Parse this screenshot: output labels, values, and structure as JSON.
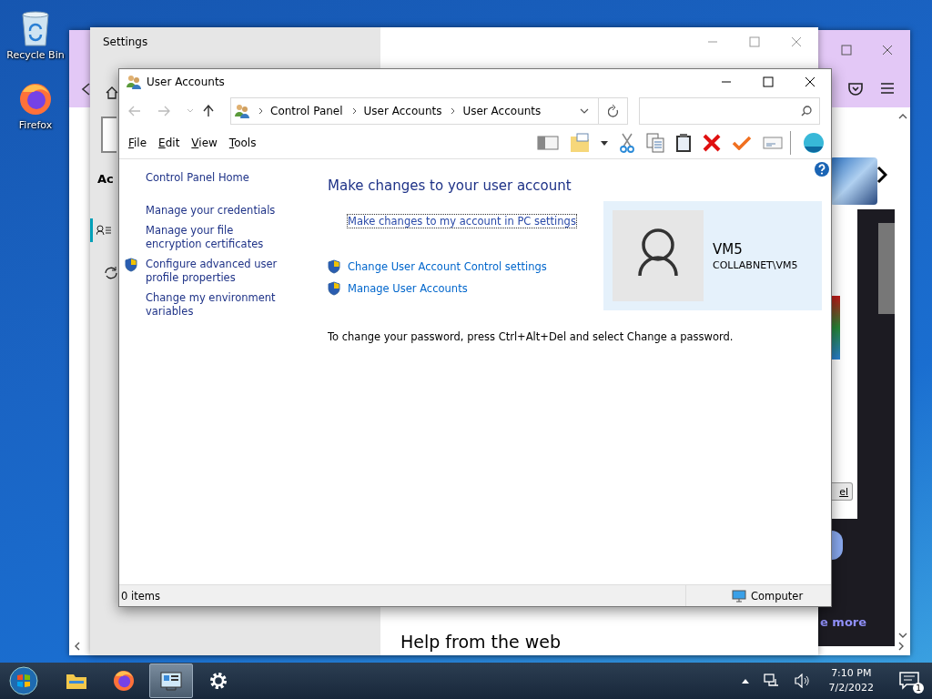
{
  "desktop_icons": [
    {
      "label": "Recycle Bin",
      "kind": "recycle"
    },
    {
      "label": "Firefox",
      "kind": "firefox"
    }
  ],
  "browser_window": {
    "partial_button": "el",
    "partial_link": "e more"
  },
  "settings_window": {
    "title": "Settings",
    "partial_heading": "Ac",
    "help_heading": "Help from the web"
  },
  "window": {
    "title": "User Accounts",
    "address": [
      "Control Panel",
      "User Accounts",
      "User Accounts"
    ],
    "menu": [
      "File",
      "Edit",
      "View",
      "Tools"
    ],
    "sidebar": [
      {
        "label": "Control Panel Home",
        "shield": false
      },
      {
        "label": "Manage your credentials",
        "shield": false
      },
      {
        "label": "Manage your file encryption certificates",
        "shield": false
      },
      {
        "label": "Configure advanced user profile properties",
        "shield": true
      },
      {
        "label": "Change my environment variables",
        "shield": false
      }
    ],
    "heading": "Make changes to your user account",
    "links": [
      {
        "label": "Make changes to my account in PC settings",
        "shield": false,
        "focused": true
      },
      {
        "label": "Change User Account Control settings",
        "shield": true,
        "focused": false
      },
      {
        "label": "Manage User Accounts",
        "shield": true,
        "focused": false
      }
    ],
    "note": "To change your password, press Ctrl+Alt+Del and select Change a password.",
    "account": {
      "name": "VM5",
      "domain": "COLLABNET\\VM5"
    },
    "status_bar": {
      "items": "0 items",
      "location": "Computer"
    }
  },
  "taskbar": {
    "apps": [
      {
        "kind": "folder",
        "selected": false
      },
      {
        "kind": "firefox",
        "selected": false
      },
      {
        "kind": "control-panel",
        "selected": true
      },
      {
        "kind": "settings",
        "selected": false
      }
    ],
    "time": "7:10 PM",
    "date": "7/2/2022",
    "notification_count": "1"
  }
}
